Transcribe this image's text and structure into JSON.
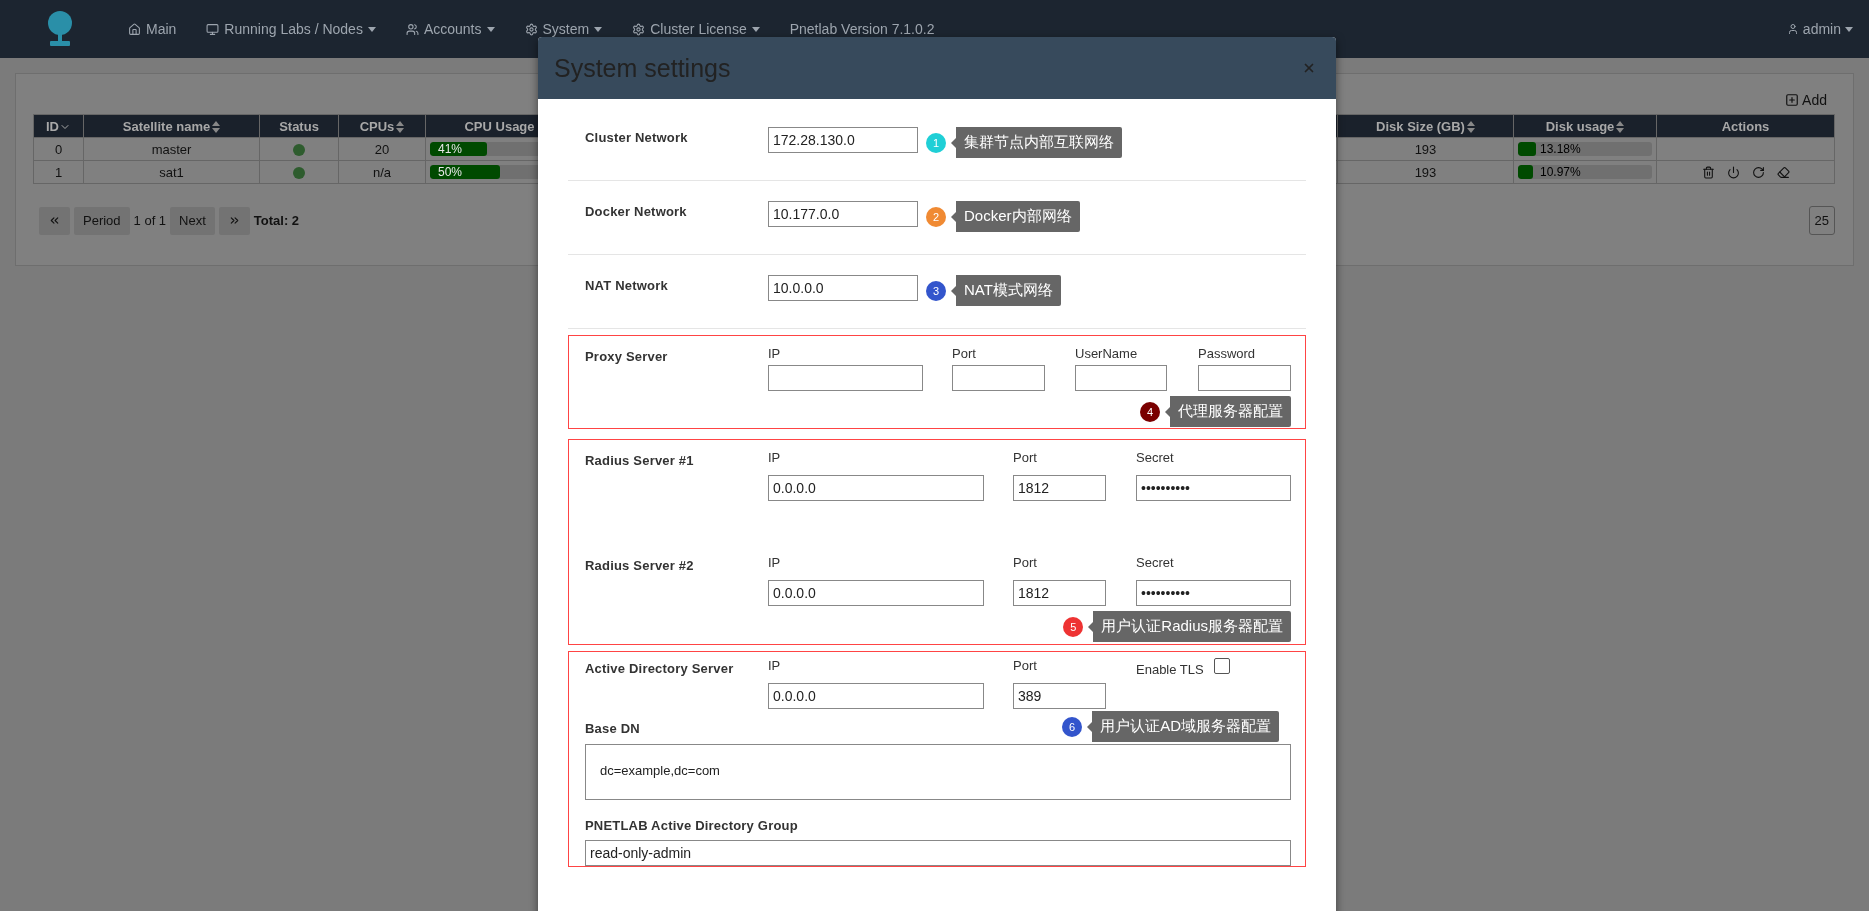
{
  "navbar": {
    "menu": [
      {
        "label": "Main",
        "dropdown": false
      },
      {
        "label": "Running Labs / Nodes",
        "dropdown": true
      },
      {
        "label": "Accounts",
        "dropdown": true
      },
      {
        "label": "System",
        "dropdown": true
      },
      {
        "label": "Cluster License",
        "dropdown": true
      },
      {
        "label": "Pnetlab Version 7.1.0.2",
        "dropdown": false
      }
    ],
    "user": "admin"
  },
  "satellites": {
    "add_button": "Add",
    "columns": [
      {
        "label": "ID",
        "sortable": true,
        "sorted": true
      },
      {
        "label": "Satellite name",
        "sortable": true,
        "sorted": false
      },
      {
        "label": "Status",
        "sortable": false
      },
      {
        "label": "CPUs",
        "sortable": true,
        "sorted": false
      },
      {
        "label": "CPU Usage",
        "sortable": false
      },
      {
        "label": "Disk Size (GB)",
        "sortable": true,
        "sorted": false
      },
      {
        "label": "Disk usage",
        "sortable": true,
        "sorted": false
      },
      {
        "label": "Actions",
        "sortable": false
      }
    ],
    "rows": [
      {
        "id": "0",
        "name": "master",
        "color": "#2e5c2e",
        "cpus": "20",
        "cpu_usage": {
          "text": "41%",
          "level": 0.41
        },
        "disk_size": "193",
        "disk_usage": {
          "text": "13.18%",
          "level": 0.1318
        },
        "actions": []
      },
      {
        "id": "1",
        "name": "sat1",
        "color": "#2e5c2e",
        "cpus": "n/a",
        "cpu_usage": {
          "text": "50%",
          "level": 0.5
        },
        "disk_size": "193",
        "disk_usage": {
          "text": "10.97%",
          "level": 0.1097
        },
        "actions": [
          {
            "kind": "delete"
          },
          {
            "kind": "power"
          },
          {
            "kind": "reload"
          },
          {
            "kind": "wipe"
          }
        ]
      }
    ],
    "pagination": {
      "previous": "Period",
      "page": "1 of 1",
      "next": "Next",
      "total": "Total: 2",
      "page_size": "25"
    }
  },
  "modal": {
    "title": "System settings",
    "networks": [
      {
        "label": "Cluster Network",
        "value": "172.28.130.0",
        "note": {
          "number": "1",
          "color": "#1fcfd6",
          "text": "集群节点内部互联网络"
        }
      },
      {
        "label": "Docker Network",
        "value": "10.177.0.0",
        "note": {
          "number": "2",
          "color": "#f08a33",
          "text": "Docker内部网络"
        }
      },
      {
        "label": "NAT Network",
        "value": "10.0.0.0",
        "note": {
          "number": "3",
          "color": "#3355cc",
          "text": "NAT模式网络"
        }
      }
    ],
    "proxy": {
      "label": "Proxy Server",
      "fields": [
        {
          "label": "IP"
        },
        {
          "label": "Port"
        },
        {
          "label": "UserName"
        },
        {
          "label": "Password"
        }
      ],
      "note": {
        "number": "4",
        "color": "#7a0000",
        "text": "代理服务器配置"
      }
    },
    "radius": {
      "servers": [
        {
          "label": "Radius Server #1",
          "ip_label": "IP",
          "ip": "0.0.0.0",
          "port_label": "Port",
          "port": "1812",
          "secret_label": "Secret",
          "secret": "••••••••••"
        },
        {
          "label": "Radius Server #2",
          "ip_label": "IP",
          "ip": "0.0.0.0",
          "port_label": "Port",
          "port": "1812",
          "secret_label": "Secret",
          "secret": "••••••••••"
        }
      ],
      "note": {
        "number": "5",
        "color": "#ee3333",
        "text": "用户认证Radius服务器配置"
      }
    },
    "active_directory": {
      "label": "Active Directory Server",
      "ip_label": "IP",
      "ip": "0.0.0.0",
      "port_label": "Port",
      "port": "389",
      "tls_label": "Enable TLS",
      "tls_checked": false,
      "base_dn_label": "Base DN",
      "base_dn": "dc=example,dc=com",
      "note": {
        "number": "6",
        "color": "#3355cc",
        "text": "用户认证AD域服务器配置"
      },
      "group_label": "PNETLAB Active Directory Group",
      "group": "read-only-admin"
    }
  }
}
